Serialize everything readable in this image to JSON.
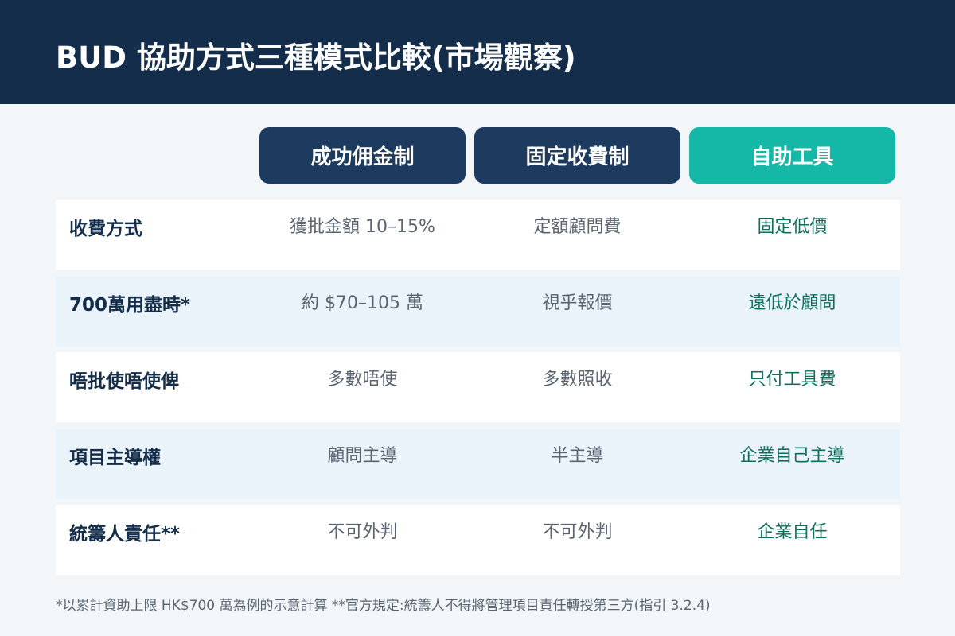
{
  "title": "BUD 協助方式三種模式比較(市場觀察)",
  "columns": [
    "成功佣金制",
    "固定收費制",
    "自助工具"
  ],
  "rows": [
    {
      "label": "收費方式",
      "values": [
        "獲批金額 10–15%",
        "定額顧問費",
        "固定低價"
      ]
    },
    {
      "label": "700萬用盡時*",
      "values": [
        "約 $70–105 萬",
        "視乎報價",
        "遠低於顧問"
      ]
    },
    {
      "label": "唔批使唔使俾",
      "values": [
        "多數唔使",
        "多數照收",
        "只付工具費"
      ]
    },
    {
      "label": "項目主導權",
      "values": [
        "顧問主導",
        "半主導",
        "企業自己主導"
      ]
    },
    {
      "label": "統籌人責任**",
      "values": [
        "不可外判",
        "不可外判",
        "企業自任"
      ]
    }
  ],
  "footnote": "*以累計資助上限 HK$700 萬為例的示意計算  **官方規定:統籌人不得將管理項目責任轉授第三方(指引 3.2.4)",
  "colors": {
    "header_bg": "#132d4a",
    "column_head_navy": "#1d3a5f",
    "column_head_teal": "#15b8a6",
    "highlight_text": "#0f6e5c",
    "row_alt_bg": "#eaf2fa"
  }
}
